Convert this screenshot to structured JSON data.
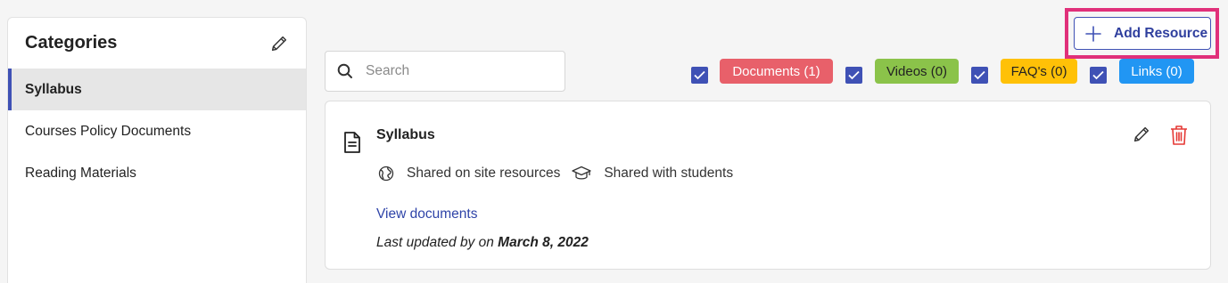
{
  "sidebar": {
    "title": "Categories",
    "items": [
      {
        "label": "Syllabus",
        "active": true
      },
      {
        "label": "Courses Policy Documents",
        "active": false
      },
      {
        "label": "Reading Materials",
        "active": false
      }
    ]
  },
  "toolbar": {
    "add_resource_label": "Add Resource"
  },
  "search": {
    "placeholder": "Search",
    "value": ""
  },
  "filters": [
    {
      "label": "Documents (1)",
      "checked": true,
      "color": "#e8606a",
      "text_color": "#ffffff"
    },
    {
      "label": "Videos (0)",
      "checked": true,
      "color": "#8bc34a",
      "text_color": "#222222"
    },
    {
      "label": "FAQ's (0)",
      "checked": true,
      "color": "#ffc107",
      "text_color": "#222222"
    },
    {
      "label": "Links (0)",
      "checked": true,
      "color": "#2196f3",
      "text_color": "#ffffff"
    }
  ],
  "resource": {
    "icon": "document-icon",
    "title": "Syllabus",
    "shared_site": "Shared on site resources",
    "shared_students": "Shared with students",
    "view_link": "View documents",
    "updated_prefix": "Last updated by on",
    "updated_date": "March 8, 2022"
  },
  "colors": {
    "accent": "#3f51b5",
    "highlight": "#e0307a",
    "delete": "#e53935"
  }
}
